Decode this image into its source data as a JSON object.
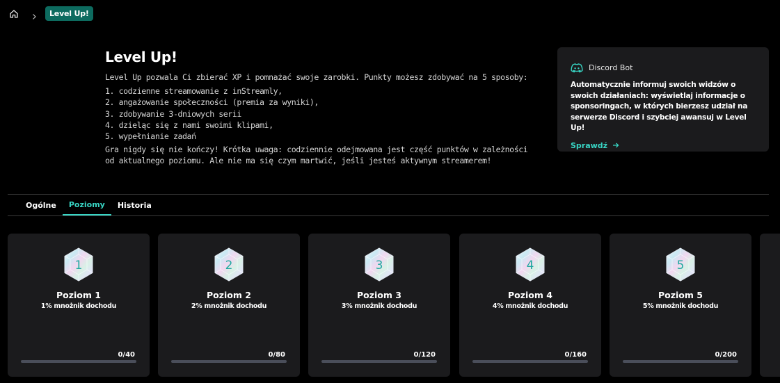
{
  "breadcrumb": {
    "current": "Level Up!"
  },
  "intro": {
    "title": "Level Up!",
    "lead": "Level Up pozwala Ci zbierać XP i pomnażać swoje zarobki. Punkty możesz zdobywać na 5 sposoby:",
    "items": [
      "1. codzienne streamowanie z inStreamly,",
      "2. angażowanie społeczności (premia za wyniki),",
      "3. zdobywanie 3-dniowych serii",
      "4. dzieląc się z nami swoimi klipami,",
      "5. wypełnianie zadań"
    ],
    "note": "Gra nigdy się nie kończy! Krótka uwaga: codziennie odejmowana jest część punktów w zależności od aktualnego poziomu. Ale nie ma się czym martwić, jeśli jesteś aktywnym streamerem!"
  },
  "discord": {
    "title": "Discord Bot",
    "text": "Automatycznie informuj swoich widzów o swoich działaniach: wyświetlaj informacje o sponsoringach, w których bierzesz udział na serwerze Discord i szybciej awansuj w Level Up!",
    "link": "Sprawdź"
  },
  "tabs": [
    {
      "label": "Ogólne",
      "active": false
    },
    {
      "label": "Poziomy",
      "active": true
    },
    {
      "label": "Historia",
      "active": false
    }
  ],
  "levels": [
    {
      "number": "1",
      "title": "Poziom 1",
      "multiplier": "1% mnożnik dochodu",
      "progress": "0/40",
      "fraction": 0
    },
    {
      "number": "2",
      "title": "Poziom 2",
      "multiplier": "2% mnożnik dochodu",
      "progress": "0/80",
      "fraction": 0
    },
    {
      "number": "3",
      "title": "Poziom 3",
      "multiplier": "3% mnożnik dochodu",
      "progress": "0/120",
      "fraction": 0
    },
    {
      "number": "4",
      "title": "Poziom 4",
      "multiplier": "4% mnożnik dochodu",
      "progress": "0/160",
      "fraction": 0
    },
    {
      "number": "5",
      "title": "Poziom 5",
      "multiplier": "5% mnożnik dochodu",
      "progress": "0/200",
      "fraction": 0
    }
  ],
  "colors": {
    "accent": "#38d5c4",
    "pill": "#0d6b5f",
    "card": "#1b1b1d",
    "track": "#4a4e5a"
  }
}
